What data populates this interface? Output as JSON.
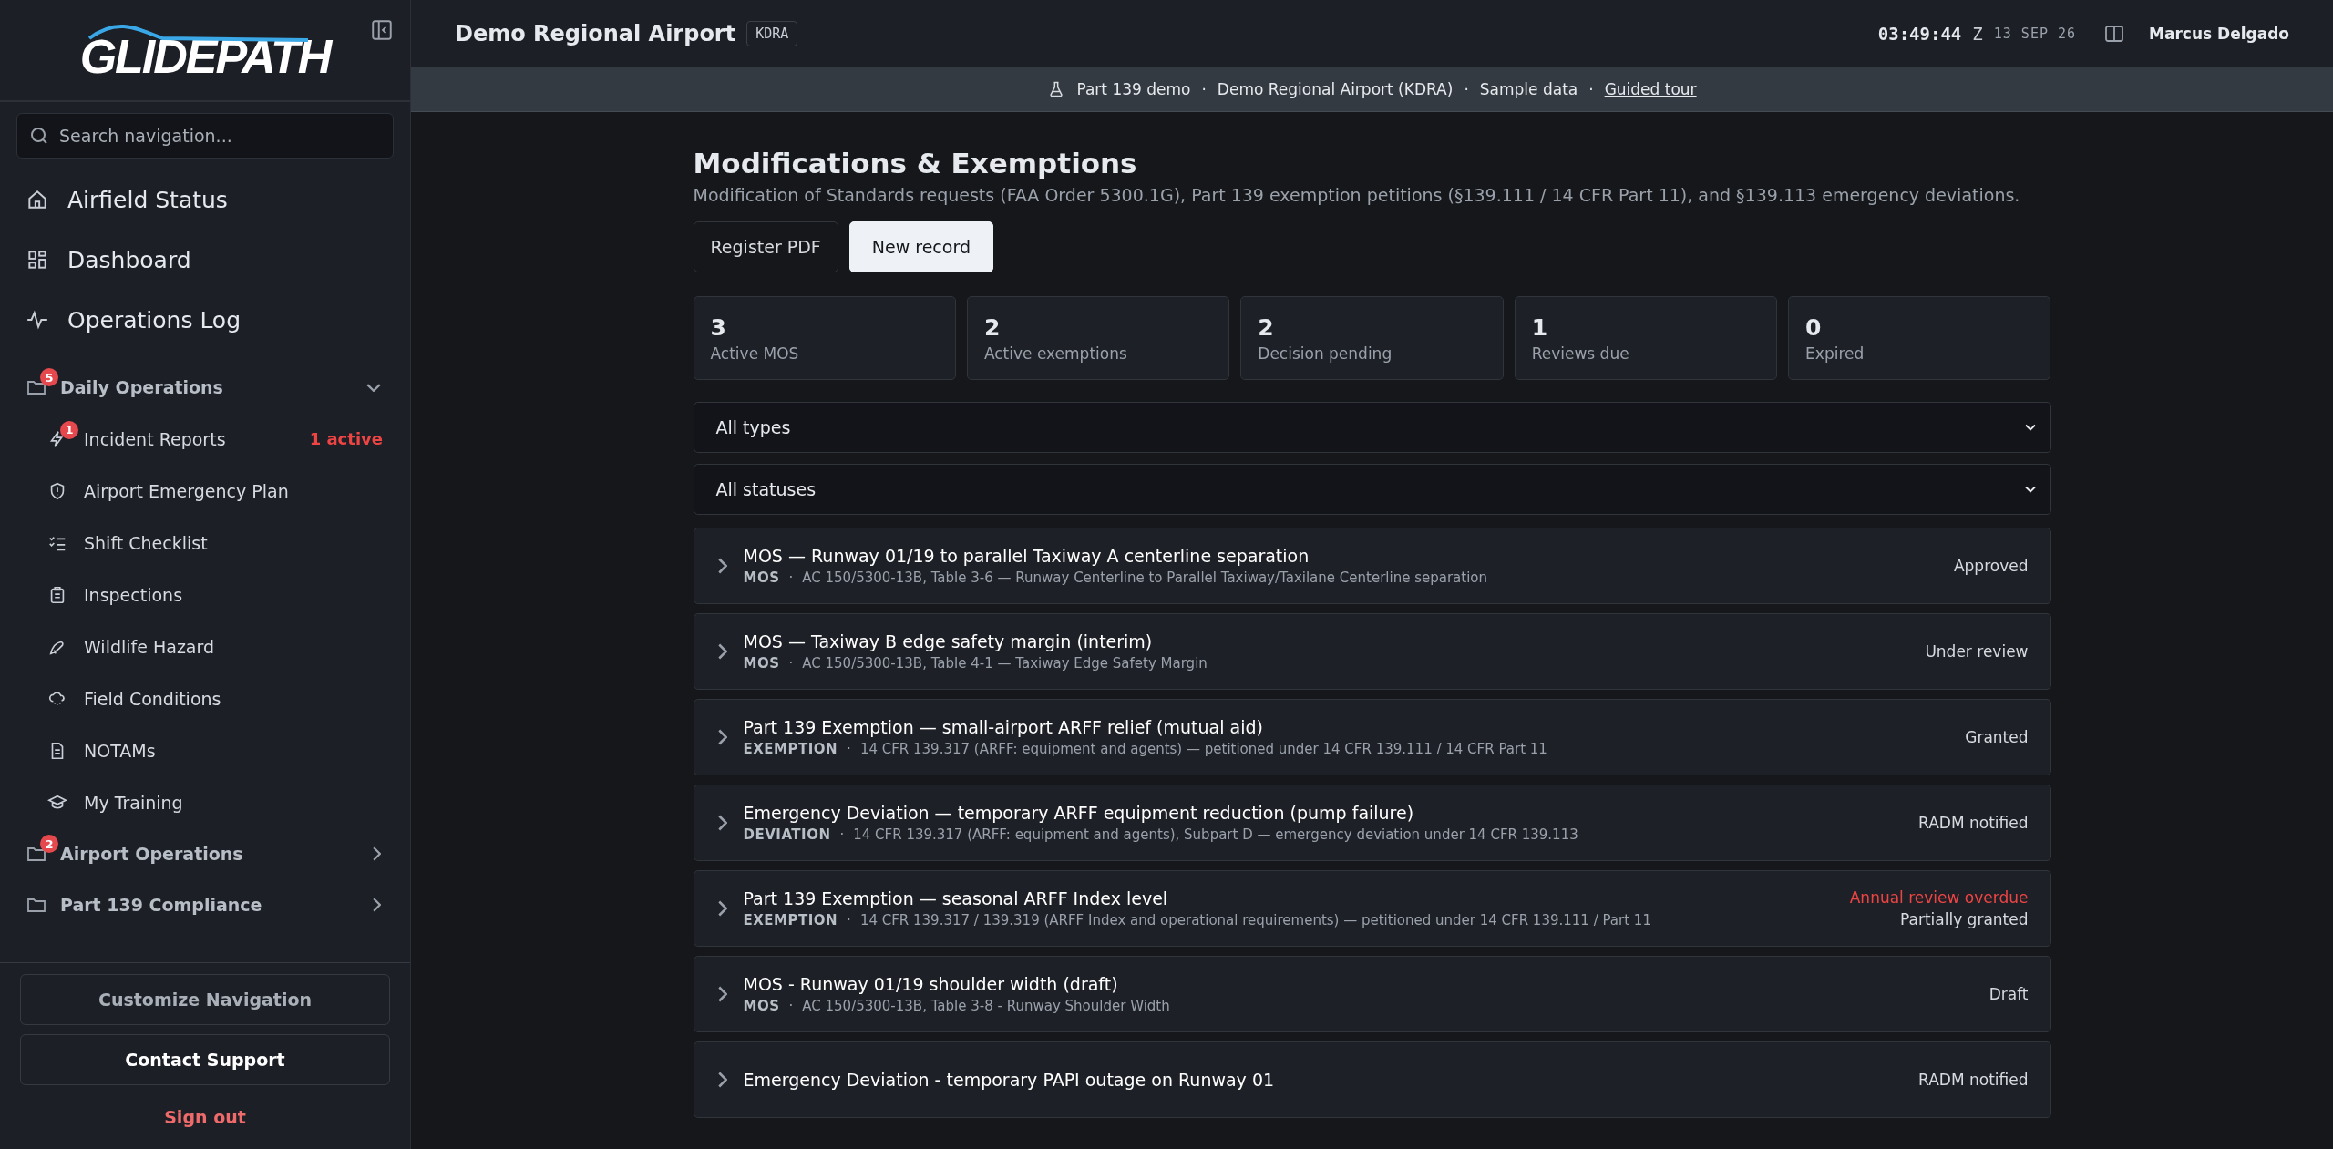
{
  "sidebar": {
    "logo": "GLIDEPATH",
    "search": {
      "placeholder": "Search navigation..."
    },
    "primary_items": [
      {
        "label": "Airfield Status"
      },
      {
        "label": "Dashboard"
      },
      {
        "label": "Operations Log"
      }
    ],
    "groups": [
      {
        "label": "Daily Operations",
        "badge": "5",
        "expanded": true,
        "children": [
          {
            "label": "Incident Reports",
            "badge": "1",
            "status": "1 active"
          },
          {
            "label": "Airport Emergency Plan"
          },
          {
            "label": "Shift Checklist"
          },
          {
            "label": "Inspections"
          },
          {
            "label": "Wildlife Hazard"
          },
          {
            "label": "Field Conditions"
          },
          {
            "label": "NOTAMs"
          },
          {
            "label": "My Training"
          }
        ]
      },
      {
        "label": "Airport Operations",
        "badge": "2",
        "expanded": false
      },
      {
        "label": "Part 139 Compliance",
        "expanded": false
      }
    ],
    "footer_buttons": [
      "Customize Navigation",
      "Contact Support"
    ],
    "sign_out": "Sign out"
  },
  "header": {
    "airport": "Demo Regional Airport",
    "code": "KDRA",
    "time": "03:49:44",
    "zone": "Z",
    "date": "13 SEP 26",
    "user": "Marcus Delgado"
  },
  "banner": {
    "items": [
      "Part 139 demo",
      "·",
      "Demo Regional Airport (KDRA)",
      "·",
      "Sample data",
      "·"
    ],
    "link": "Guided tour"
  },
  "page": {
    "title": "Modifications & Exemptions",
    "subtitle": "Modification of Standards requests (FAA Order 5300.1G), Part 139 exemption petitions (§139.111 / 14 CFR Part 11), and §139.113 emergency deviations.",
    "buttons": [
      {
        "label": "Register PDF",
        "primary": false
      },
      {
        "label": "New record",
        "primary": true
      }
    ],
    "stats": [
      {
        "value": "3",
        "label": "Active MOS"
      },
      {
        "value": "2",
        "label": "Active exemptions"
      },
      {
        "value": "2",
        "label": "Decision pending"
      },
      {
        "value": "1",
        "label": "Reviews due"
      },
      {
        "value": "0",
        "label": "Expired"
      }
    ],
    "filters": [
      {
        "value": "All types"
      },
      {
        "value": "All statuses"
      }
    ],
    "records": [
      {
        "title": "MOS — Runway 01/19 to parallel Taxiway A centerline separation",
        "type": "MOS",
        "separator": "·",
        "reference": "AC 150/5300-13B, Table 3-6 — Runway Centerline to Parallel Taxiway/Taxilane Centerline separation",
        "status": "Approved",
        "expanded": false
      },
      {
        "title": "MOS — Taxiway B edge safety margin (interim)",
        "type": "MOS",
        "separator": "·",
        "reference": "AC 150/5300-13B, Table 4-1 — Taxiway Edge Safety Margin",
        "status": "Under review",
        "expanded": false
      },
      {
        "title": "Part 139 Exemption — small-airport ARFF relief (mutual aid)",
        "type": "EXEMPTION",
        "separator": "·",
        "reference": "14 CFR 139.317 (ARFF: equipment and agents) — petitioned under 14 CFR 139.111 / 14 CFR Part 11",
        "status": "Granted",
        "expanded": false
      },
      {
        "title": "Emergency Deviation — temporary ARFF equipment reduction (pump failure)",
        "type": "DEVIATION",
        "separator": "·",
        "reference": "14 CFR 139.317 (ARFF: equipment and agents), Subpart D — emergency deviation under 14 CFR 139.113",
        "status": "RADM notified",
        "expanded": false
      },
      {
        "title": "Part 139 Exemption — seasonal ARFF Index level",
        "type": "EXEMPTION",
        "separator": "·",
        "reference": "14 CFR 139.317 / 139.319 (ARFF Index and operational requirements) — petitioned under 14 CFR 139.111 / Part 11",
        "status": "Partially granted",
        "alert": "Annual review overdue",
        "expanded": false
      },
      {
        "title": "MOS - Runway 01/19 shoulder width (draft)",
        "type": "MOS",
        "separator": "·",
        "reference": "AC 150/5300-13B, Table 3-8 - Runway Shoulder Width",
        "status": "Draft",
        "expanded": false
      },
      {
        "title": "Emergency Deviation - temporary PAPI outage on Runway 01",
        "status": "RADM notified",
        "expanded": false
      }
    ]
  }
}
